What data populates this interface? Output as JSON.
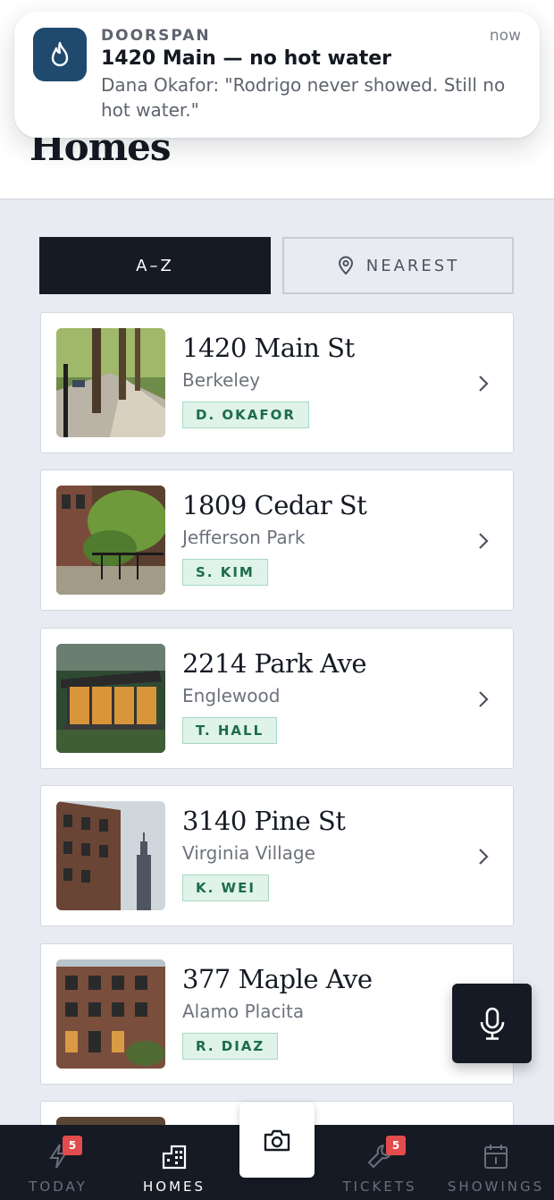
{
  "header": {
    "title": "Homes"
  },
  "notification": {
    "app": "DOORSPAN",
    "time": "now",
    "title": "1420 Main — no hot water",
    "body": "Dana Okafor: \"Rodrigo never showed. Still no hot water.\"",
    "icon": "flame-icon"
  },
  "sort": {
    "az_label": "A–Z",
    "nearest_label": "NEAREST",
    "selected": "A–Z"
  },
  "properties": [
    {
      "street": "1420 Main St",
      "area": "Berkeley",
      "tenant": "D. OKAFOR"
    },
    {
      "street": "1809 Cedar St",
      "area": "Jefferson Park",
      "tenant": "S. KIM"
    },
    {
      "street": "2214 Park Ave",
      "area": "Englewood",
      "tenant": "T. HALL"
    },
    {
      "street": "3140 Pine St",
      "area": "Virginia Village",
      "tenant": "K. WEI"
    },
    {
      "street": "377 Maple Ave",
      "area": "Alamo Placita",
      "tenant": "R. DIAZ"
    }
  ],
  "nav": {
    "today": {
      "label": "TODAY",
      "badge": "5"
    },
    "homes": {
      "label": "HOMES"
    },
    "tickets": {
      "label": "TICKETS",
      "badge": "5"
    },
    "showings": {
      "label": "SHOWINGS"
    }
  },
  "colors": {
    "accent": "#151a24",
    "tag_bg": "#dff3ea",
    "tag_text": "#1d6b4d",
    "badge": "#e34c4c"
  }
}
